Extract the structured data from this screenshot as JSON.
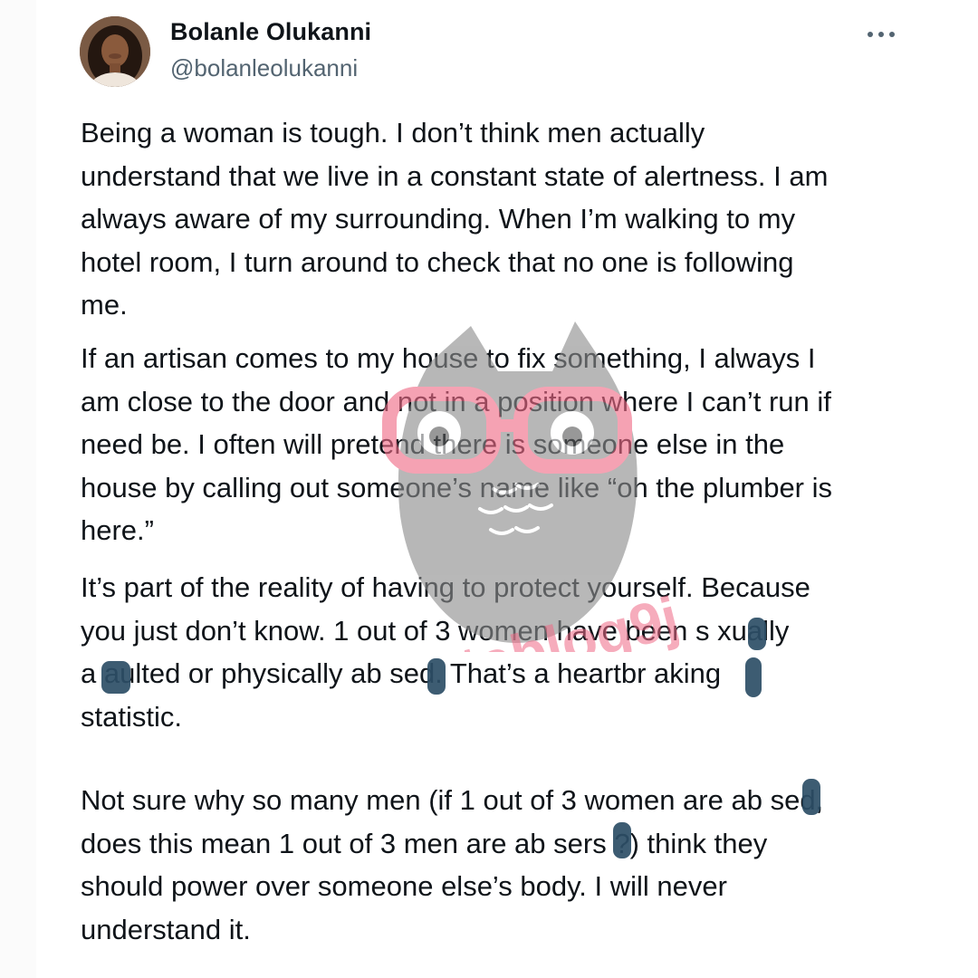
{
  "post": {
    "author": {
      "display_name": "Bolanle Olukanni",
      "handle": "@bolanleolukanni"
    },
    "more_icon": "more-horizontal-icon",
    "paragraphs": [
      "Being a woman is tough. I don’t think men actually\nunderstand that we live in a constant state of alertness. I am\nalways aware of my surrounding. When I’m walking to my\nhotel room, I turn around to check that no one is following\nme.",
      "If an artisan comes to my house to fix something, I always I\nam close to the door and not in a position where I can’t run if\nneed be. I often will pretend there is someone else in the\nhouse by calling out someone’s name like “oh the plumber is\nhere.”",
      "It’s part of the reality of having to protect yourself. Because\nyou just don’t know. 1 out of 3 women have been s xually\na  aulted or physically ab  sed. That’s a heartbr  aking\nstatistic.",
      "Not sure why so many men (if 1 out of 3 women are ab  sed,\ndoes this mean 1 out of 3 men are ab  sers ?) think they\nshould power over someone else’s body. I will never\nunderstand it."
    ]
  },
  "watermark": {
    "text": "instablog9ja",
    "colors": {
      "owl": "#8c8c8c",
      "glasses": "#f06a86"
    }
  },
  "colors": {
    "text": "#0f1419",
    "secondary_text": "#536471",
    "redaction": "#2c4e66"
  }
}
